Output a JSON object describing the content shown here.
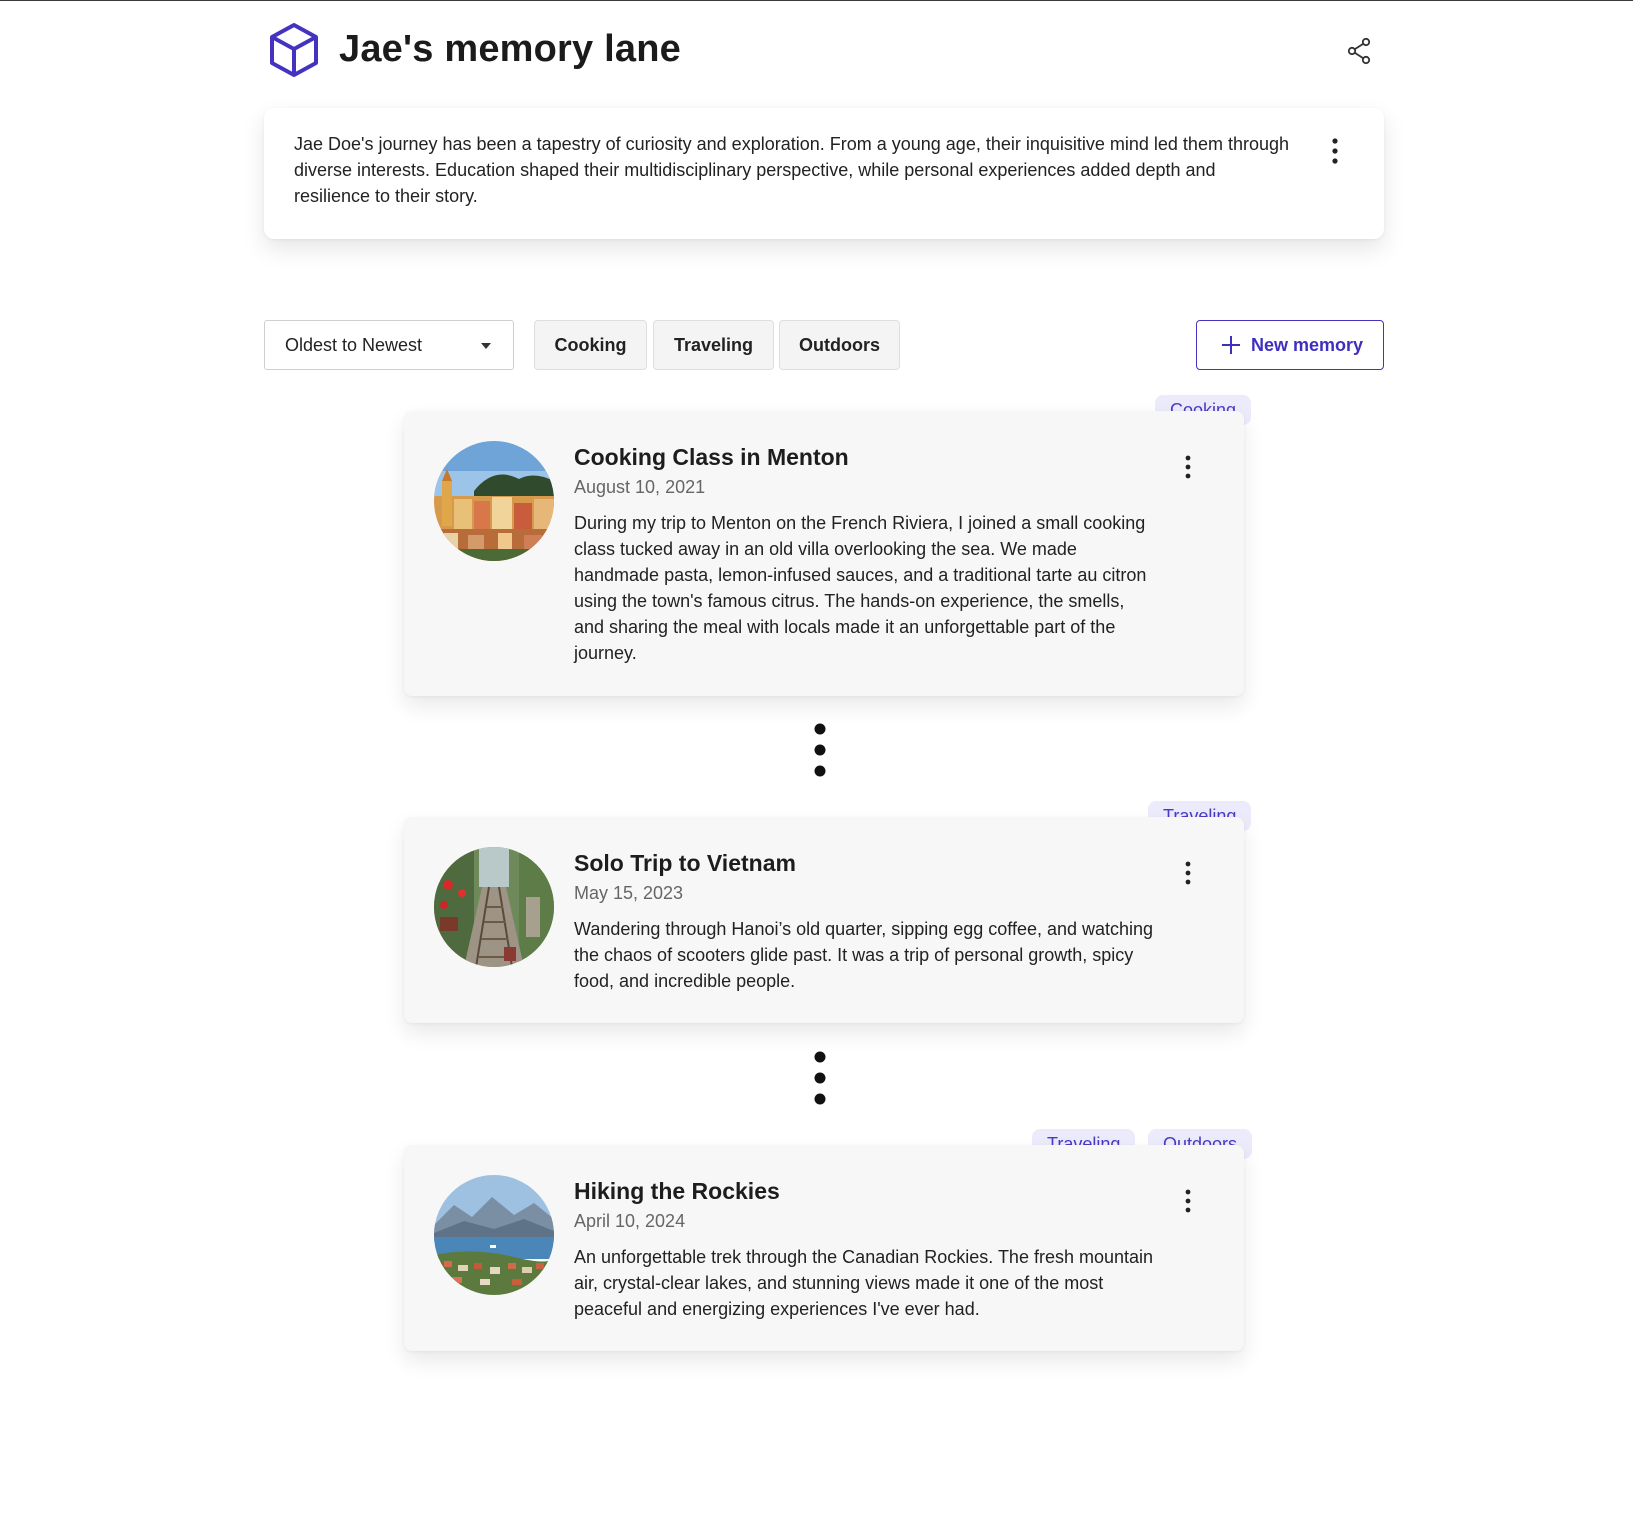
{
  "header": {
    "title": "Jae's memory lane",
    "logo_icon": "cube-icon",
    "share_icon": "share-icon",
    "accent_color": "#4433c0"
  },
  "bio": {
    "text": "Jae Doe's journey has been a tapestry of curiosity and exploration. From a young age, their inquisitive mind led them through diverse interests. Education shaped their multidisciplinary perspective, while personal experiences added depth and resilience to their story.",
    "menu_icon": "more-vertical-icon"
  },
  "toolbar": {
    "sort": {
      "selected": "Oldest to Newest"
    },
    "filters": [
      {
        "label": "Cooking"
      },
      {
        "label": "Traveling"
      },
      {
        "label": "Outdoors"
      }
    ],
    "new_memory_label": "New memory"
  },
  "memories": [
    {
      "title": "Cooking Class in Menton",
      "date": "August 10, 2021",
      "description": "During my trip to Menton on the French Riviera, I joined a small cooking class tucked away in an old villa overlooking the sea. We made handmade pasta, lemon-infused sauces, and a traditional tarte au citron using the town's famous citrus. The hands-on experience, the smells, and sharing the meal with locals made it an unforgettable part of the journey.",
      "tags": [
        "Cooking"
      ],
      "photo_icon": "menton-town-photo"
    },
    {
      "title": "Solo Trip to Vietnam",
      "date": "May 15, 2023",
      "description": "Wandering through Hanoi’s old quarter, sipping egg coffee, and watching the chaos of scooters glide past. It was a trip of personal growth, spicy food, and incredible people.",
      "tags": [
        "Traveling"
      ],
      "photo_icon": "hanoi-train-street-photo"
    },
    {
      "title": "Hiking the Rockies",
      "date": "April 10, 2024",
      "description": "An unforgettable trek through the Canadian Rockies. The fresh mountain air, crystal-clear lakes, and stunning views made it one of the most peaceful and energizing experiences I've ever had.",
      "tags": [
        "Traveling",
        "Outdoors"
      ],
      "photo_icon": "mountain-bay-photo"
    }
  ]
}
